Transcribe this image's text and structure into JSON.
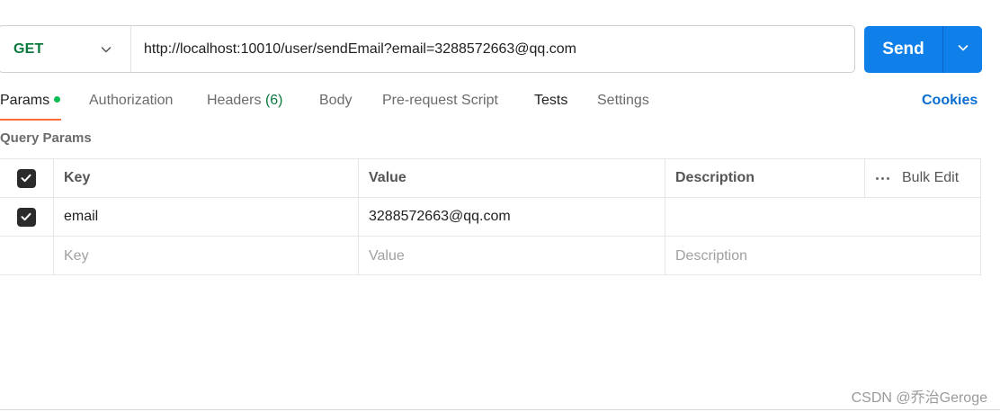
{
  "request": {
    "method": "GET",
    "url": "http://localhost:10010/user/sendEmail?email=3288572663@qq.com",
    "send_label": "Send"
  },
  "tabs": [
    {
      "label": "Params",
      "has_dot": true
    },
    {
      "label": "Authorization"
    },
    {
      "label": "Headers",
      "count": "(6)"
    },
    {
      "label": "Body"
    },
    {
      "label": "Pre-request Script"
    },
    {
      "label": "Tests"
    },
    {
      "label": "Settings"
    }
  ],
  "cookies_label": "Cookies",
  "query_params": {
    "title": "Query Params",
    "headers": {
      "key": "Key",
      "value": "Value",
      "description": "Description",
      "bulk_edit": "Bulk Edit"
    },
    "rows": [
      {
        "checked": true,
        "key": "email",
        "value": "3288572663@qq.com",
        "description": ""
      }
    ],
    "placeholders": {
      "key": "Key",
      "value": "Value",
      "description": "Description"
    }
  },
  "watermark": "CSDN @乔治Geroge",
  "colors": {
    "method_get": "#0a7a3d",
    "send_button": "#0f7fea",
    "active_tab_underline": "#ff6c37",
    "status_dot": "#0cbb52",
    "link": "#0b6ed0"
  }
}
